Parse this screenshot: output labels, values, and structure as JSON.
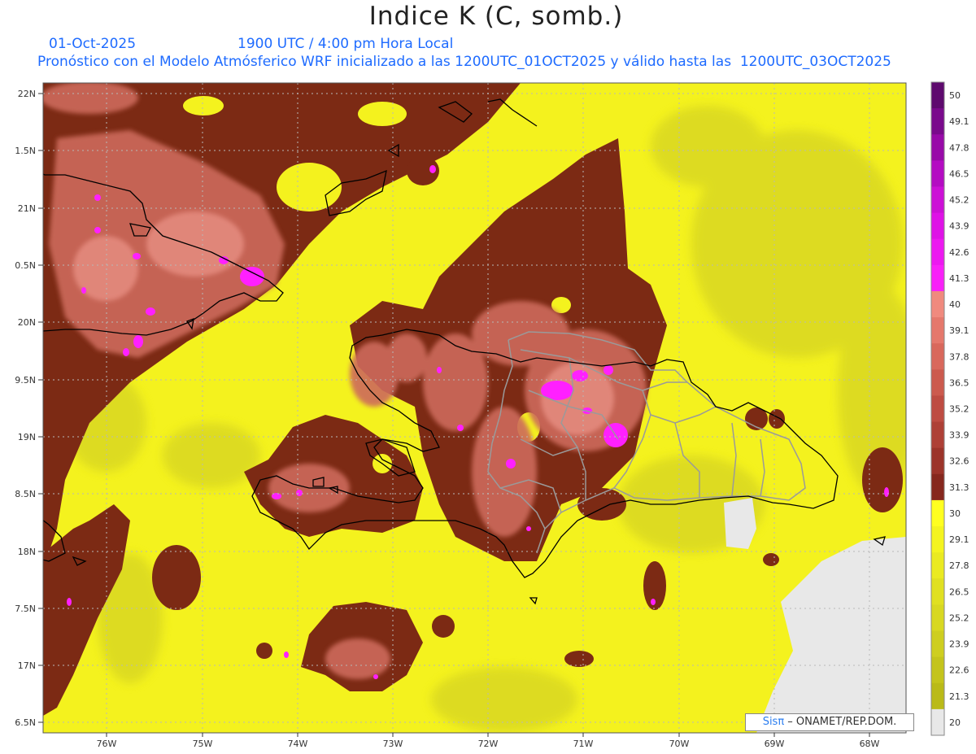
{
  "header": {
    "title": "Indice K (C, somb.)",
    "date": "01-Oct-2025",
    "time": "1900 UTC / 4:00 pm Hora Local",
    "description": "Pronóstico con el Modelo Atmósferico WRF inicializado a las 1200UTC_01OCT2025 y válido hasta las  1200UTC_03OCT2025"
  },
  "axes": {
    "lat_labels": [
      "22N",
      "1.5N",
      "21N",
      "0.5N",
      "20N",
      "9.5N",
      "19N",
      "8.5N",
      "18N",
      "7.5N",
      "17N",
      "6.5N"
    ],
    "lon_labels": [
      "76W",
      "75W",
      "74W",
      "73W",
      "72W",
      "71W",
      "70W",
      "69W",
      "68W"
    ]
  },
  "colorbar": {
    "labels": [
      "50",
      "49.1",
      "47.8",
      "46.5",
      "45.2",
      "43.9",
      "42.6",
      "41.3",
      "40",
      "39.1",
      "37.8",
      "36.5",
      "35.2",
      "33.9",
      "32.6",
      "31.3",
      "30",
      "29.1",
      "27.8",
      "26.5",
      "25.2",
      "23.9",
      "22.6",
      "21.3",
      "20"
    ],
    "colors": [
      "#5e0a6e",
      "#7a0a8c",
      "#980aa8",
      "#b40cc2",
      "#cc10d6",
      "#de12e6",
      "#ec18f0",
      "#f820f8",
      "#f08a7e",
      "#e5786c",
      "#d9685c",
      "#cc5a4e",
      "#be4c42",
      "#ae4036",
      "#9c342a",
      "#86281e",
      "#ffff20",
      "#f4f420",
      "#eaea22",
      "#e0e022",
      "#d8d822",
      "#cece20",
      "#c4c41c",
      "#baba18",
      "#e8e8e8"
    ]
  },
  "credit": {
    "brand": "Sisπ",
    "org": " – ONAMET/REP.DOM."
  },
  "colors": {
    "cape_low": "#ffff20",
    "mid": "#d4d422",
    "high": "#7c2a14",
    "very_high": "#c8645a",
    "extreme": "#ff20ff",
    "land_blank": "#e8e8e8"
  }
}
